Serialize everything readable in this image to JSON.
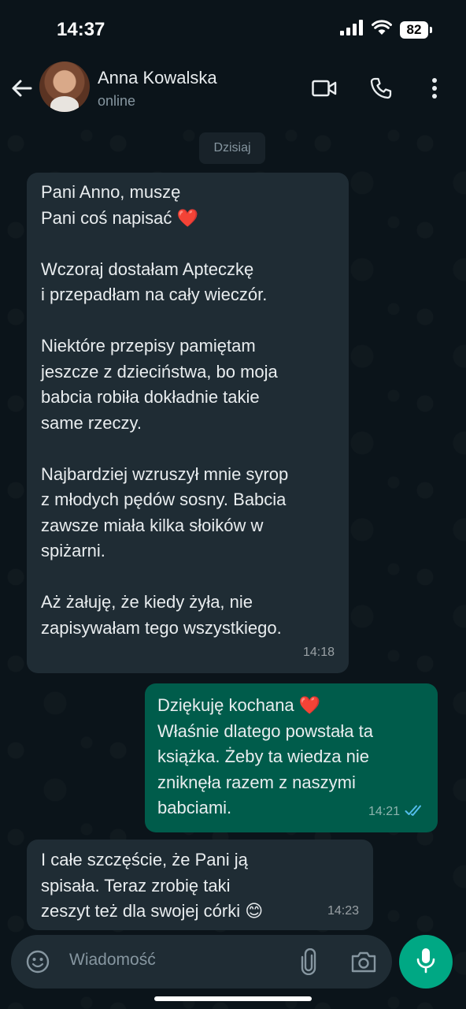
{
  "status_bar": {
    "time": "14:37",
    "battery": "82"
  },
  "header": {
    "contact_name": "Anna Kowalska",
    "contact_status": "online"
  },
  "date_chip": "Dzisiaj",
  "messages": [
    {
      "direction": "incoming",
      "paragraphs": [
        [
          "Pani Anno, muszę",
          "Pani coś napisać"
        ],
        [
          "Wczoraj dostałam Apteczkę",
          "i przepadłam na cały wieczór."
        ],
        [
          "Niektóre przepisy pamiętam",
          "jeszcze z dzieciństwa, bo moja",
          "babcia robiła dokładnie takie",
          "same rzeczy."
        ],
        [
          "Najbardziej wzruszył mnie syrop",
          "z młodych pędów sosny. Babcia",
          "zawsze miała kilka słoików w",
          "spiżarni."
        ],
        [
          "Aż żałuję, że kiedy żyła, nie",
          "zapisywałam tego wszystkiego."
        ]
      ],
      "time": "14:18"
    },
    {
      "direction": "outgoing",
      "lines": [
        "Dziękuję kochana",
        "Właśnie dlatego powstała ta",
        "książka. Żeby ta wiedza nie",
        "zniknęła razem z naszymi",
        "babciami."
      ],
      "time": "14:21",
      "status": "read"
    },
    {
      "direction": "incoming",
      "lines": [
        "I całe szczęście, że Pani ją",
        "spisała. Teraz zrobię taki",
        "zeszyt też dla swojej córki"
      ],
      "time": "14:23"
    }
  ],
  "emoji": {
    "heart": "❤️",
    "smile": "😊"
  },
  "composer": {
    "placeholder": "Wiadomość"
  },
  "colors": {
    "background": "#0b141a",
    "incoming_bubble": "#1f2c34",
    "outgoing_bubble": "#005c4b",
    "accent": "#00a884",
    "read_ticks": "#53bdeb"
  },
  "icons": [
    "back-arrow-icon",
    "video-call-icon",
    "phone-icon",
    "more-vert-icon",
    "emoji-icon",
    "attach-icon",
    "camera-icon",
    "mic-icon",
    "double-check-icon",
    "signal-icon",
    "wifi-icon",
    "battery-icon"
  ]
}
